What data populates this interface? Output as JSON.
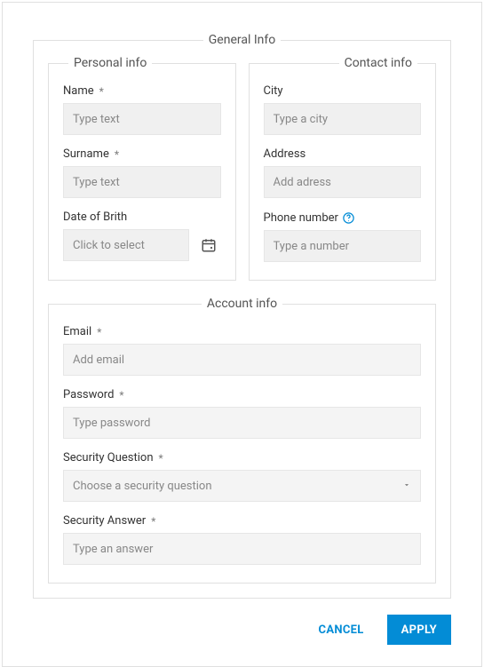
{
  "general": {
    "legend": "General Info",
    "personal": {
      "legend": "Personal info",
      "name": {
        "label": "Name",
        "required": "*",
        "placeholder": "Type text",
        "value": ""
      },
      "surname": {
        "label": "Surname",
        "required": "*",
        "placeholder": "Type text",
        "value": ""
      },
      "dob": {
        "label": "Date of Brith",
        "placeholder": "Click to select",
        "value": ""
      }
    },
    "contact": {
      "legend": "Contact info",
      "city": {
        "label": "City",
        "placeholder": "Type a city",
        "value": ""
      },
      "address": {
        "label": "Address",
        "placeholder": "Add adress",
        "value": ""
      },
      "phone": {
        "label": "Phone number",
        "placeholder": "Type a number",
        "value": ""
      }
    },
    "account": {
      "legend": "Account info",
      "email": {
        "label": "Email",
        "required": "*",
        "placeholder": "Add email",
        "value": ""
      },
      "password": {
        "label": "Password",
        "required": "*",
        "placeholder": "Type password",
        "value": ""
      },
      "security_question": {
        "label": "Security Question",
        "required": "*",
        "placeholder": "Choose a security question",
        "value": ""
      },
      "security_answer": {
        "label": "Security Answer",
        "required": "*",
        "placeholder": "Type an answer",
        "value": ""
      }
    }
  },
  "footer": {
    "cancel": "CANCEL",
    "apply": "APPLY"
  }
}
